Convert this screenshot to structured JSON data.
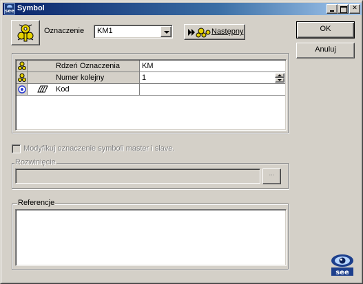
{
  "window": {
    "title": "Symbol",
    "app_icon_text": "see",
    "controls": {
      "minimize": "",
      "maximize": "",
      "close": "✕"
    }
  },
  "top": {
    "designation_label": "Oznaczenie",
    "designation_value": "KM1",
    "next_button_label": "Następny"
  },
  "dialog_buttons": {
    "ok": "OK",
    "cancel": "Anuluj"
  },
  "properties": [
    {
      "name": "Rdzeń Oznaczenia",
      "value": "KM",
      "icon": "symbol-gear-icon"
    },
    {
      "name": "Numer kolejny",
      "value": "1",
      "icon": "symbol-gear-icon",
      "spinner": true
    },
    {
      "name": "Kod",
      "value": "",
      "icon": "settings-radio-icon",
      "sub_icon": "book-icon"
    }
  ],
  "modify_checkbox": {
    "label": "Modyfikuj oznaczenie symboli master i slave.",
    "checked": false,
    "enabled": false
  },
  "expansion": {
    "legend": "Rozwinięcie",
    "value": "",
    "browse_label": "..."
  },
  "references": {
    "legend": "Referencje",
    "value": ""
  },
  "brand": {
    "logo_text": "see"
  }
}
